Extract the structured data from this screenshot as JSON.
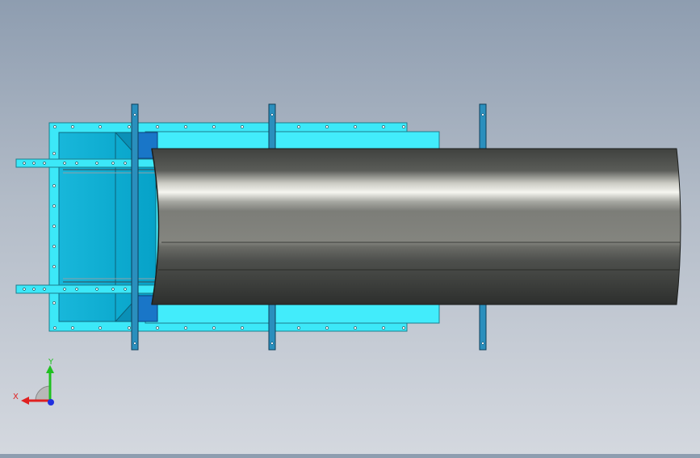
{
  "viewport": {
    "background_top": "#8e9db0",
    "background_bottom": "#d4d8df"
  },
  "model": {
    "frame_color": "#3ce8f8",
    "inner_color": "#07a8cc",
    "duct_color": "#4a4c4a",
    "duct_highlight": "#f4f4ee",
    "rib_color": "#1a7fae"
  },
  "triad": {
    "x_label": "X",
    "y_label": "Y",
    "x_color": "#e02020",
    "y_color": "#20c020",
    "z_color": "#2030e0"
  }
}
